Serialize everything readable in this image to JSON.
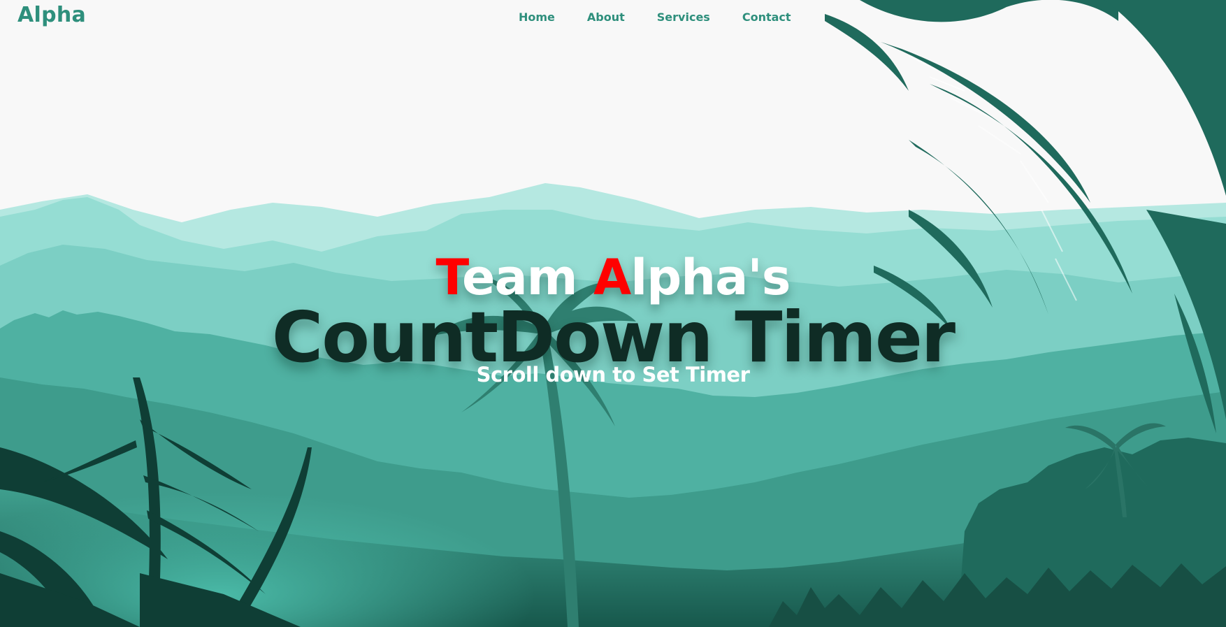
{
  "nav": {
    "logo": "Alpha",
    "links": [
      "Home",
      "About",
      "Services",
      "Contact"
    ]
  },
  "hero": {
    "title_accent_1": "T",
    "title_part_1": "eam ",
    "title_accent_2": "A",
    "title_part_2": "lpha's",
    "headline": "CountDown Timer",
    "subtitle": "Scroll down to Set Timer"
  },
  "colors": {
    "brand": "#2e8f7c",
    "accent": "#ff0000",
    "headline": "#0f2c25",
    "sky": "#f8f8f8"
  }
}
